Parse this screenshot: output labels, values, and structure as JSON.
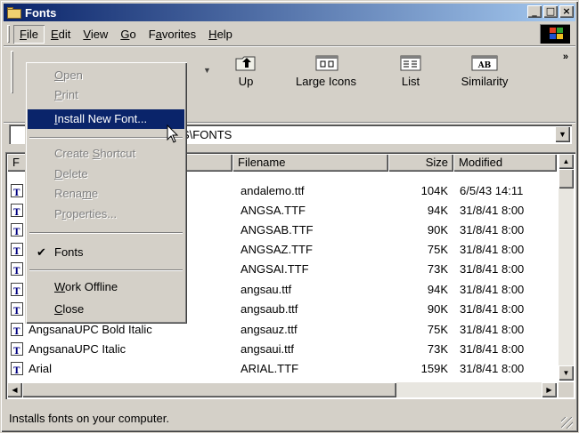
{
  "window": {
    "title": "Fonts"
  },
  "menubar": {
    "items": [
      {
        "label": "File",
        "key": "F",
        "rest": "ile"
      },
      {
        "label": "Edit",
        "key": "E",
        "rest": "dit"
      },
      {
        "label": "View",
        "key": "V",
        "rest": "iew"
      },
      {
        "label": "Go",
        "key": "G",
        "rest": "o"
      },
      {
        "label": "Favorites",
        "pre": "F",
        "key": "a",
        "rest": "vorites"
      },
      {
        "label": "Help",
        "key": "H",
        "rest": "elp"
      }
    ]
  },
  "toolbar": {
    "up_label": "Up",
    "large_icons_label": "Large Icons",
    "list_label": "List",
    "similarity_label": "Similarity",
    "similarity_icon_text": "AB",
    "more": "»"
  },
  "address": {
    "value": "S\\FONTS"
  },
  "file_menu": {
    "items": [
      {
        "pre": "",
        "key": "O",
        "rest": "pen"
      },
      {
        "pre": "",
        "key": "P",
        "rest": "rint"
      },
      {
        "pre": "",
        "key": "I",
        "rest": "nstall New Font..."
      },
      {
        "pre": "Create ",
        "key": "S",
        "rest": "hortcut"
      },
      {
        "pre": "",
        "key": "D",
        "rest": "elete"
      },
      {
        "pre": "Rena",
        "key": "m",
        "rest": "e"
      },
      {
        "pre": "P",
        "key": "r",
        "rest": "operties..."
      },
      {
        "pre": "Fonts",
        "key": "",
        "rest": ""
      },
      {
        "pre": "",
        "key": "W",
        "rest": "ork Offline"
      },
      {
        "pre": "",
        "key": "C",
        "rest": "lose"
      }
    ],
    "check_mark": "✔"
  },
  "list": {
    "columns": {
      "name": "F",
      "filename": "Filename",
      "size": "Size",
      "modified": "Modified"
    },
    "rows": [
      {
        "name": "",
        "filename": "andalemo.ttf",
        "size": "104K",
        "modified": "6/5/43 14:11"
      },
      {
        "name": "",
        "filename": "ANGSA.TTF",
        "size": "94K",
        "modified": "31/8/41 8:00"
      },
      {
        "name": "",
        "filename": "ANGSAB.TTF",
        "size": "90K",
        "modified": "31/8/41 8:00"
      },
      {
        "name": "",
        "filename": "ANGSAZ.TTF",
        "size": "75K",
        "modified": "31/8/41 8:00"
      },
      {
        "name": "",
        "filename": "ANGSAI.TTF",
        "size": "73K",
        "modified": "31/8/41 8:00"
      },
      {
        "name": "",
        "filename": "angsau.ttf",
        "size": "94K",
        "modified": "31/8/41 8:00"
      },
      {
        "name": "",
        "filename": "angsaub.ttf",
        "size": "90K",
        "modified": "31/8/41 8:00"
      },
      {
        "name": "AngsanaUPC Bold Italic",
        "filename": "angsauz.ttf",
        "size": "75K",
        "modified": "31/8/41 8:00"
      },
      {
        "name": "AngsanaUPC Italic",
        "filename": "angsaui.ttf",
        "size": "73K",
        "modified": "31/8/41 8:00"
      },
      {
        "name": "Arial",
        "filename": "ARIAL.TTF",
        "size": "159K",
        "modified": "31/8/41 8:00"
      }
    ]
  },
  "statusbar": {
    "text": "Installs fonts on your computer."
  }
}
